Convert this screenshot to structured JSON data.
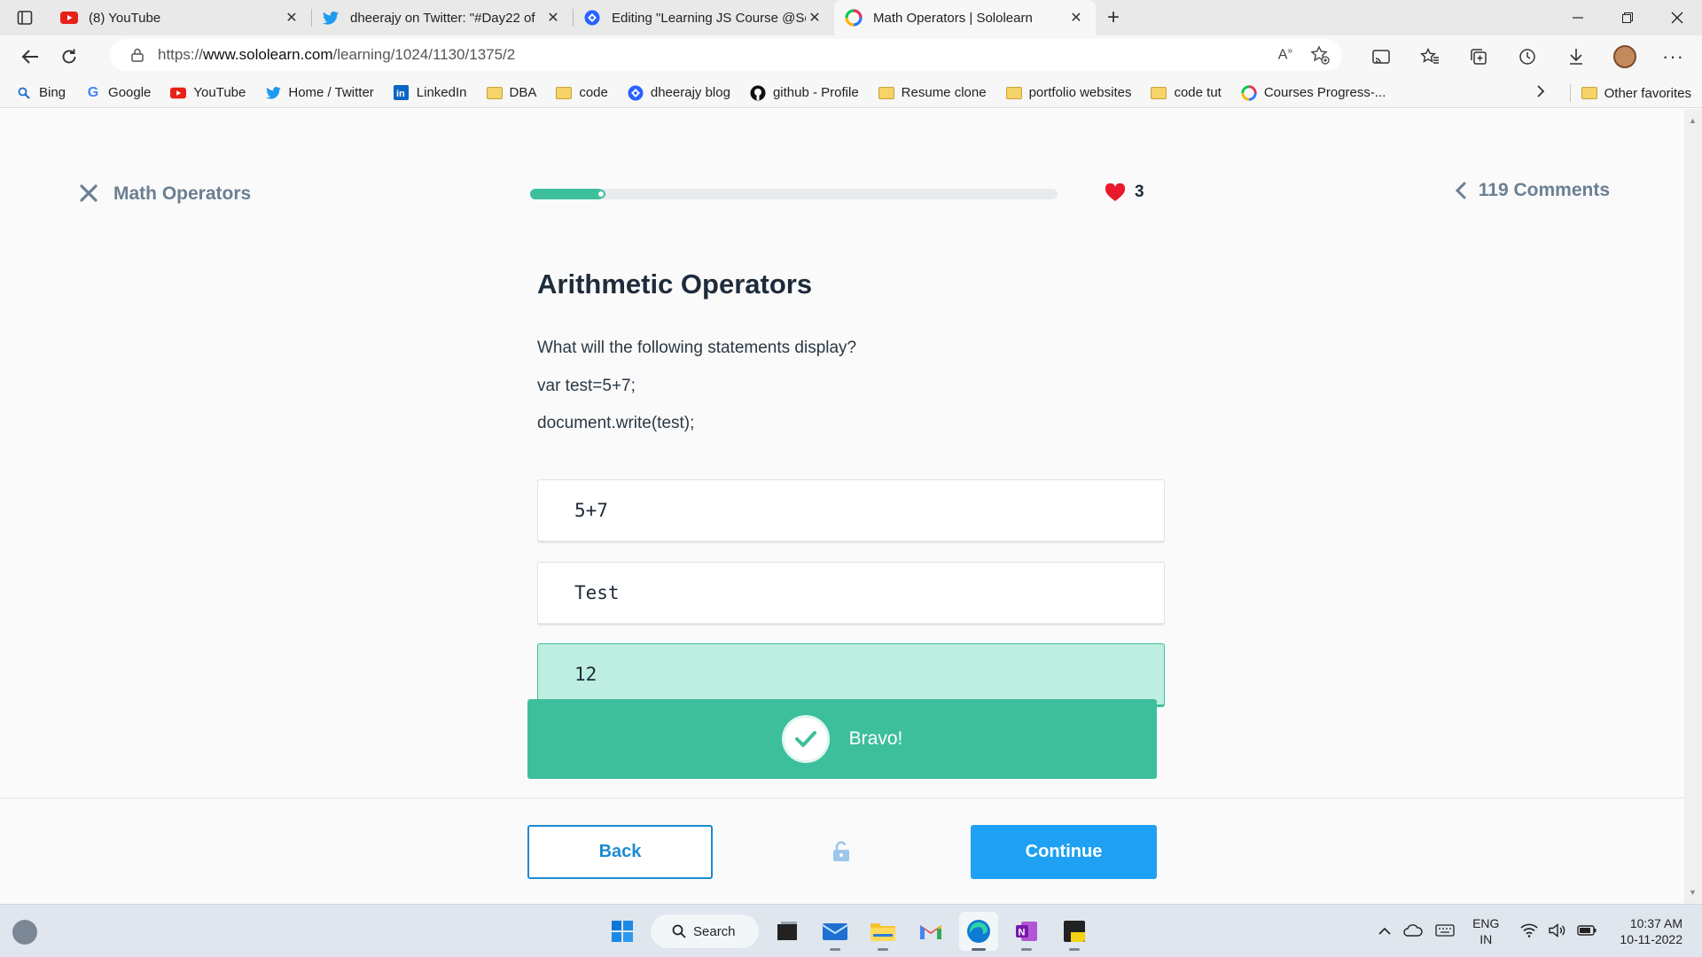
{
  "browser": {
    "tabs": [
      {
        "title": "(8) YouTube",
        "icon": "youtube-icon",
        "active": false
      },
      {
        "title": "dheerajy on Twitter: \"#Day22 of",
        "icon": "twitter-icon",
        "active": false
      },
      {
        "title": "Editing \"Learning JS Course @So",
        "icon": "blog-icon",
        "active": false
      },
      {
        "title": "Math Operators | Sololearn",
        "icon": "sololearn-icon",
        "active": true
      }
    ],
    "new_tab": "+",
    "url_prefix": "https://",
    "url_host": "www.sololearn.com",
    "url_path": "/learning/1024/1130/1375/2",
    "bookmarks": [
      {
        "label": "Bing",
        "icon": "bing-icon"
      },
      {
        "label": "Google",
        "icon": "google-icon"
      },
      {
        "label": "YouTube",
        "icon": "youtube-icon"
      },
      {
        "label": "Home / Twitter",
        "icon": "twitter-icon"
      },
      {
        "label": "LinkedIn",
        "icon": "linkedin-icon"
      },
      {
        "label": "DBA",
        "icon": "folder-icon"
      },
      {
        "label": "code",
        "icon": "folder-icon"
      },
      {
        "label": "dheerajy blog",
        "icon": "blog-icon"
      },
      {
        "label": "github - Profile",
        "icon": "github-icon"
      },
      {
        "label": "Resume clone",
        "icon": "folder-icon"
      },
      {
        "label": "portfolio websites",
        "icon": "folder-icon"
      },
      {
        "label": "code tut",
        "icon": "folder-icon"
      },
      {
        "label": "Courses Progress-...",
        "icon": "sololearn-icon"
      }
    ],
    "other_favorites": "Other favorites"
  },
  "lesson": {
    "name": "Math Operators",
    "progress_fraction": 0.14,
    "hearts": "3",
    "comments": "119 Comments"
  },
  "question": {
    "title": "Arithmetic Operators",
    "prompt": "What will the following statements display?",
    "code_line_1": "var test=5+7;",
    "code_line_2": "document.write(test);",
    "options": [
      "5+7",
      "Test",
      "12"
    ],
    "correct_index": 2
  },
  "feedback": {
    "message": "Bravo!"
  },
  "footer": {
    "back_label": "Back",
    "continue_label": "Continue"
  },
  "taskbar": {
    "search_label": "Search",
    "lang_line1": "ENG",
    "lang_line2": "IN",
    "time": "10:37 AM",
    "date": "10-11-2022"
  },
  "colors": {
    "accent_green": "#3dbf9c",
    "correct_bg": "#bdeee0",
    "continue_blue": "#1ea1f2",
    "heart_red": "#e8192c"
  }
}
